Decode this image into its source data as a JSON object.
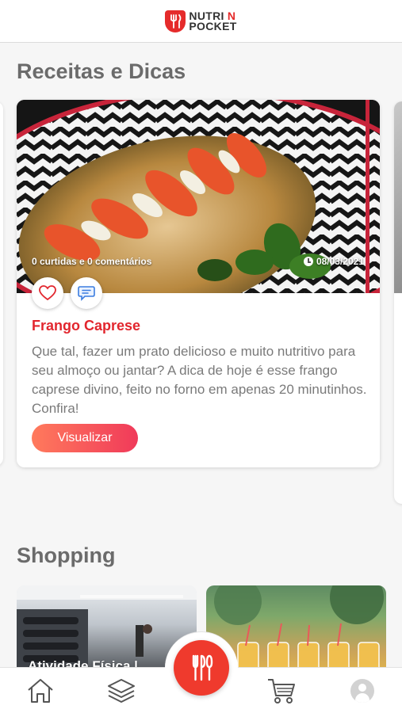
{
  "header": {
    "logo_line1": "NUTRI",
    "logo_n": "N",
    "logo_line2": "POCKET"
  },
  "recipes": {
    "title": "Receitas e Dicas",
    "card": {
      "stats": "0 curtidas e 0 comentários",
      "date": "08/03/2021",
      "title": "Frango Caprese",
      "description": "Que tal, fazer um prato delicioso e muito nutritivo para seu almoço ou jantar? A dica de hoje é esse frango caprese divino, feito no forno em apenas 20 minutinhos. Confira!",
      "button": "Visualizar"
    }
  },
  "shopping": {
    "title": "Shopping",
    "cards": [
      {
        "label": "Atividade Física |"
      },
      {
        "label": ""
      }
    ]
  },
  "nav": {
    "items": [
      "home-icon",
      "layers-icon",
      "cutlery-icon",
      "cart-icon",
      "profile-icon"
    ]
  },
  "colors": {
    "accent": "#e2262e",
    "fab": "#ef3a2d",
    "title": "#6b6b6b"
  }
}
